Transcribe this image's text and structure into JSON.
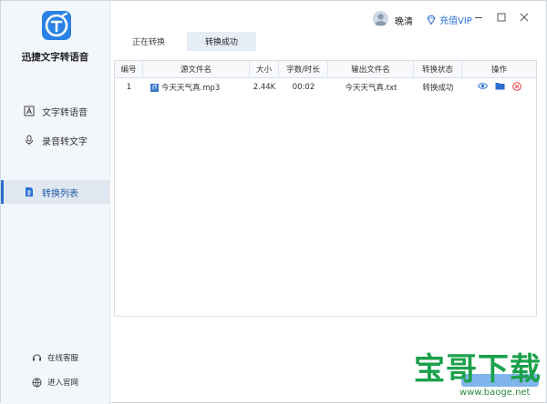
{
  "app": {
    "name": "迅捷文字转语音"
  },
  "sidebar": {
    "items": [
      {
        "label": "文字转语音",
        "icon": "text-to-speech-icon"
      },
      {
        "label": "录音转文字",
        "icon": "microphone-icon"
      },
      {
        "label": "转换列表",
        "icon": "list-icon",
        "active": true
      }
    ],
    "footer": [
      {
        "label": "在线客服",
        "icon": "headset-icon"
      },
      {
        "label": "进入官网",
        "icon": "globe-icon"
      }
    ]
  },
  "header": {
    "username": "晚清",
    "vip_label": "充值VIP",
    "controls": [
      "minimize-icon",
      "maximize-icon",
      "close-icon"
    ]
  },
  "tabs": [
    {
      "label": "正在转换",
      "active": false
    },
    {
      "label": "转换成功",
      "active": true
    }
  ],
  "table": {
    "columns": [
      "编号",
      "源文件名",
      "大小",
      "字数/时长",
      "输出文件名",
      "转换状态",
      "操作"
    ],
    "rows": [
      {
        "index": "1",
        "source": "今天天气真.mp3",
        "size": "2.44K",
        "duration": "00:02",
        "output": "今天天气真.txt",
        "status": "转换成功",
        "actions": [
          "eye-icon",
          "folder-icon",
          "delete-icon"
        ]
      }
    ]
  },
  "watermark": {
    "text": "宝哥下载",
    "url": "www.baoge.net"
  },
  "colors": {
    "accent": "#2a82e4",
    "sidebar_bg": "#f3f6fa",
    "delete": "#e23b3b",
    "watermark": "#1aa14b"
  }
}
